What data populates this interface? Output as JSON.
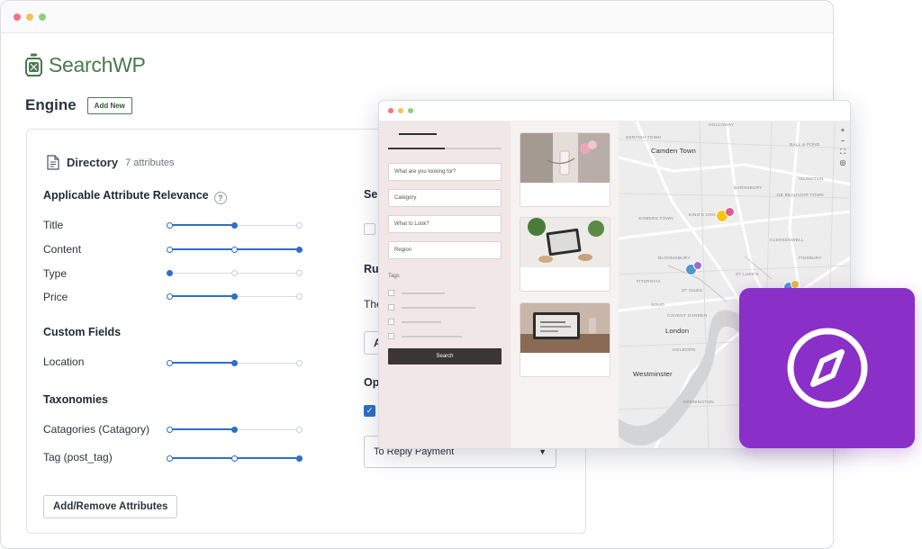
{
  "app": {
    "logo_text": "SearchWP",
    "logo_icon": "lantern-icon"
  },
  "engine": {
    "title": "Engine",
    "add_new_label": "Add New"
  },
  "directory": {
    "title": "Directory",
    "count": "7 attributes",
    "icon": "document-icon"
  },
  "relevance": {
    "section_title": "Applicable Attribute Relevance",
    "help_icon": "question-circle-icon",
    "rows": [
      {
        "label": "Title",
        "level": 0.5
      },
      {
        "label": "Content",
        "level": 1.0
      },
      {
        "label": "Type",
        "level": 0.0
      },
      {
        "label": "Price",
        "level": 0.5
      }
    ]
  },
  "custom_fields": {
    "section_title": "Custom Fields",
    "rows": [
      {
        "label": "Location",
        "level": 0.5
      }
    ]
  },
  "taxonomies": {
    "section_title": "Taxonomies",
    "rows": [
      {
        "label": "Catagories (Catagory)",
        "level": 0.5
      },
      {
        "label": "Tag (post_tag)",
        "level": 1.0
      }
    ]
  },
  "add_remove_label": "Add/Remove Attributes",
  "right_col": {
    "heading1": "Se",
    "heading2": "Ru",
    "the_text": "The",
    "input_a": "A",
    "heading3": "Op",
    "select_value": "To Reply Payment",
    "checkbox_checked": true
  },
  "front": {
    "search_placeholder": "What are you looking for?",
    "category_placeholder": "Category",
    "what_placeholder": "What to Look?",
    "region_placeholder": "Region",
    "tags_label": "Tags",
    "search_button": "Search",
    "progress": 0.5
  },
  "map_labels": [
    "HOLLOWAY",
    "KENTISH TOWN",
    "BALL & POND",
    "Camden Town",
    "BARNSBURY",
    "ISLINGTON",
    "DE BEAUVOIR TOWN",
    "SOMERS TOWN",
    "KING'S CROSS",
    "CLERKENWELL",
    "FINSBURY",
    "BLOOMSBURY",
    "FITZROVIA",
    "ST LUKE'S",
    "ST GILES",
    "SOHO",
    "COVENT GARDEN",
    "London",
    "Westminster",
    "HOLBORN",
    "BOROUGH",
    "KENNINGTON",
    "NEWINGTON"
  ],
  "map_controls": [
    "+",
    "−"
  ],
  "compass_icon": "compass-icon",
  "colors": {
    "brand_green": "#4a7a4f",
    "accent_blue": "#2f6fc7",
    "tile_purple": "#8b2fc9"
  }
}
